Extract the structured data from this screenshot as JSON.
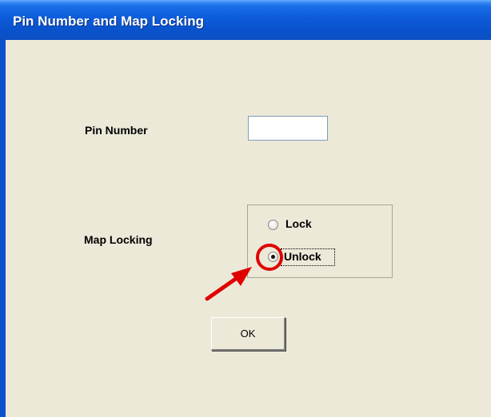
{
  "window": {
    "title": "Pin Number and Map Locking"
  },
  "form": {
    "pin_label": "Pin Number",
    "pin_value": "",
    "map_locking_label": "Map Locking",
    "options": [
      {
        "label": "Lock",
        "checked": false
      },
      {
        "label": "Unlock",
        "checked": true
      }
    ],
    "ok_label": "OK"
  },
  "annotation": {
    "highlight_color": "#e00000",
    "target": "Unlock"
  }
}
